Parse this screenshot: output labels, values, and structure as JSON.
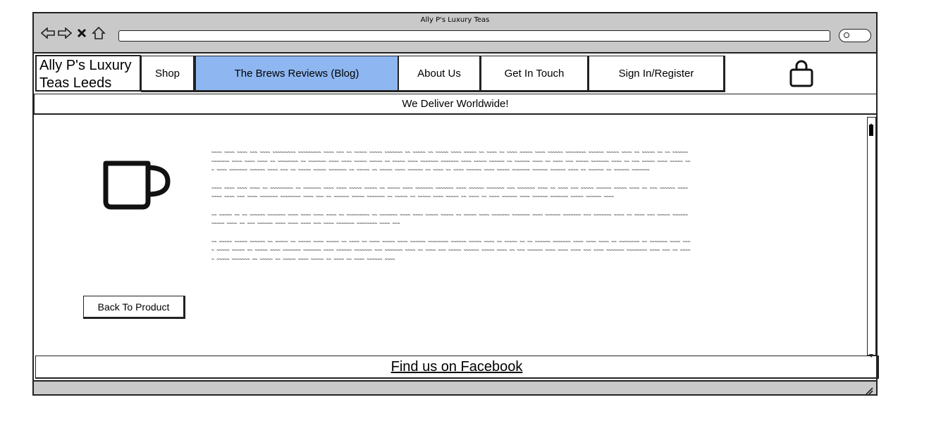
{
  "window": {
    "title": "Ally P's Luxury Teas"
  },
  "toolbar": {
    "icons": [
      "back-arrow-icon",
      "forward-arrow-icon",
      "stop-icon",
      "home-icon",
      "search-icon"
    ],
    "url_value": ""
  },
  "nav": {
    "logo": "Ally P's Luxury Teas Leeds",
    "items": [
      {
        "label": "Shop",
        "active": false
      },
      {
        "label": "The Brews Reviews (Blog)",
        "active": true
      },
      {
        "label": "About Us",
        "active": false
      },
      {
        "label": "Get In Touch",
        "active": false
      },
      {
        "label": "Sign In/Register",
        "active": false
      }
    ],
    "cart_icon": "shopping-bag-icon",
    "active_color": "#8eb6f0"
  },
  "banner": {
    "text": "We Deliver Worldwide!"
  },
  "content": {
    "image_icon": "mug-icon",
    "back_button": "Back To Product"
  },
  "footer": {
    "link": "Find us on Facebook"
  }
}
